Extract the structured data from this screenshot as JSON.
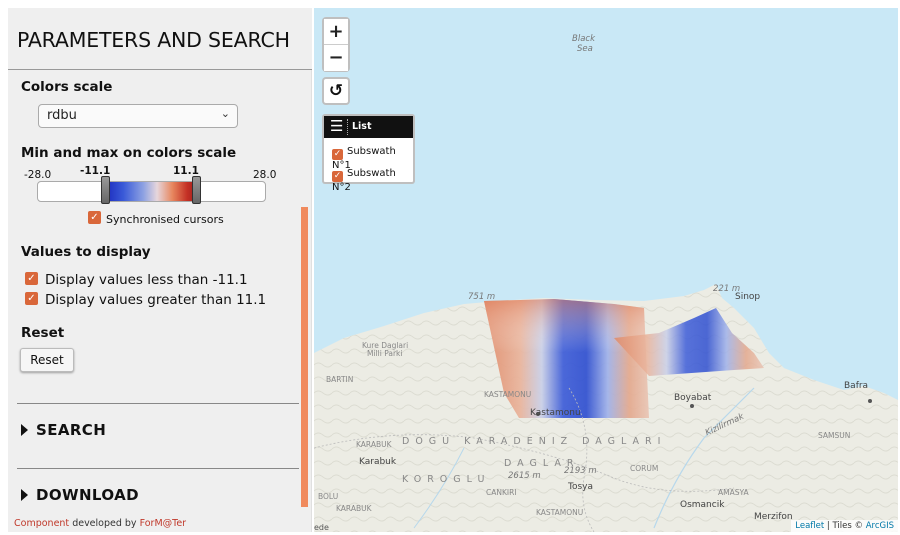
{
  "panel": {
    "title": "PARAMETERS AND SEARCH",
    "colors_scale": {
      "heading": "Colors scale",
      "selected": "rdbu"
    },
    "minmax": {
      "heading": "Min and max on colors scale",
      "min": "-28.0",
      "low": "-11.1",
      "high": "11.1",
      "max": "28.0",
      "low_fraction": 0.302,
      "high_fraction": 0.698,
      "sync_label": "Synchronised cursors",
      "sync_checked": true
    },
    "values": {
      "heading": "Values to display",
      "less_label": "Display values less than -11.1",
      "greater_label": "Display values greater than 11.1",
      "less_checked": true,
      "greater_checked": true
    },
    "reset": {
      "heading": "Reset",
      "button": "Reset"
    },
    "search_label": "SEARCH",
    "download_label": "DOWNLOAD",
    "footer": {
      "component": "Component",
      "developed": "developed by",
      "former": "ForM@Ter"
    }
  },
  "map": {
    "zoom_in": "+",
    "zoom_out": "−",
    "reset_view": "↺",
    "layers": {
      "title": "List",
      "items": [
        "Subswath N°1",
        "Subswath N°2"
      ]
    },
    "labels": {
      "black_sea_1": "Black",
      "black_sea_2": "Sea",
      "elev_751": "751 m",
      "elev_221": "221 m",
      "sinop": "Sinop",
      "kure_1": "Kure Daglari",
      "kure_2": "Milli Parki",
      "bartin": "BARTIN",
      "kastamonu_prov": "KASTAMONU",
      "kastamonu": "Kastamonu",
      "boyabat": "Boyabat",
      "bafra": "Bafra",
      "kizilirmak": "Kizilirmak",
      "dogu": "DOGU  KARADENIZ  DAGLARI",
      "karabuk_prov": "KARABUK",
      "karabuk": "Karabuk",
      "koroglu": "KOROGLU",
      "daglar": "DAGLAR",
      "elev_2193": "2193 m",
      "elev_2615": "2615 m",
      "corum_prov": "CORUM",
      "samsun_prov": "SAMSUN",
      "cankiri": "CANKIRI",
      "tosya": "Tosya",
      "amasya": "AMASYA",
      "karabuk2": "KARABUK",
      "bolu": "BOLU",
      "kastamonu2": "KASTAMONU",
      "osmancik": "Osmancik",
      "merzifon": "Merzifon",
      "edge": "ede"
    },
    "attribution": {
      "leaflet": "Leaflet",
      "tiles": "| Tiles ©",
      "arcgis": "ArcGIS"
    }
  },
  "colors": {
    "accent": "#d9673a",
    "scrollbar": "#f08a5d",
    "sea": "#c9e8f6",
    "land": "#ecece4"
  }
}
